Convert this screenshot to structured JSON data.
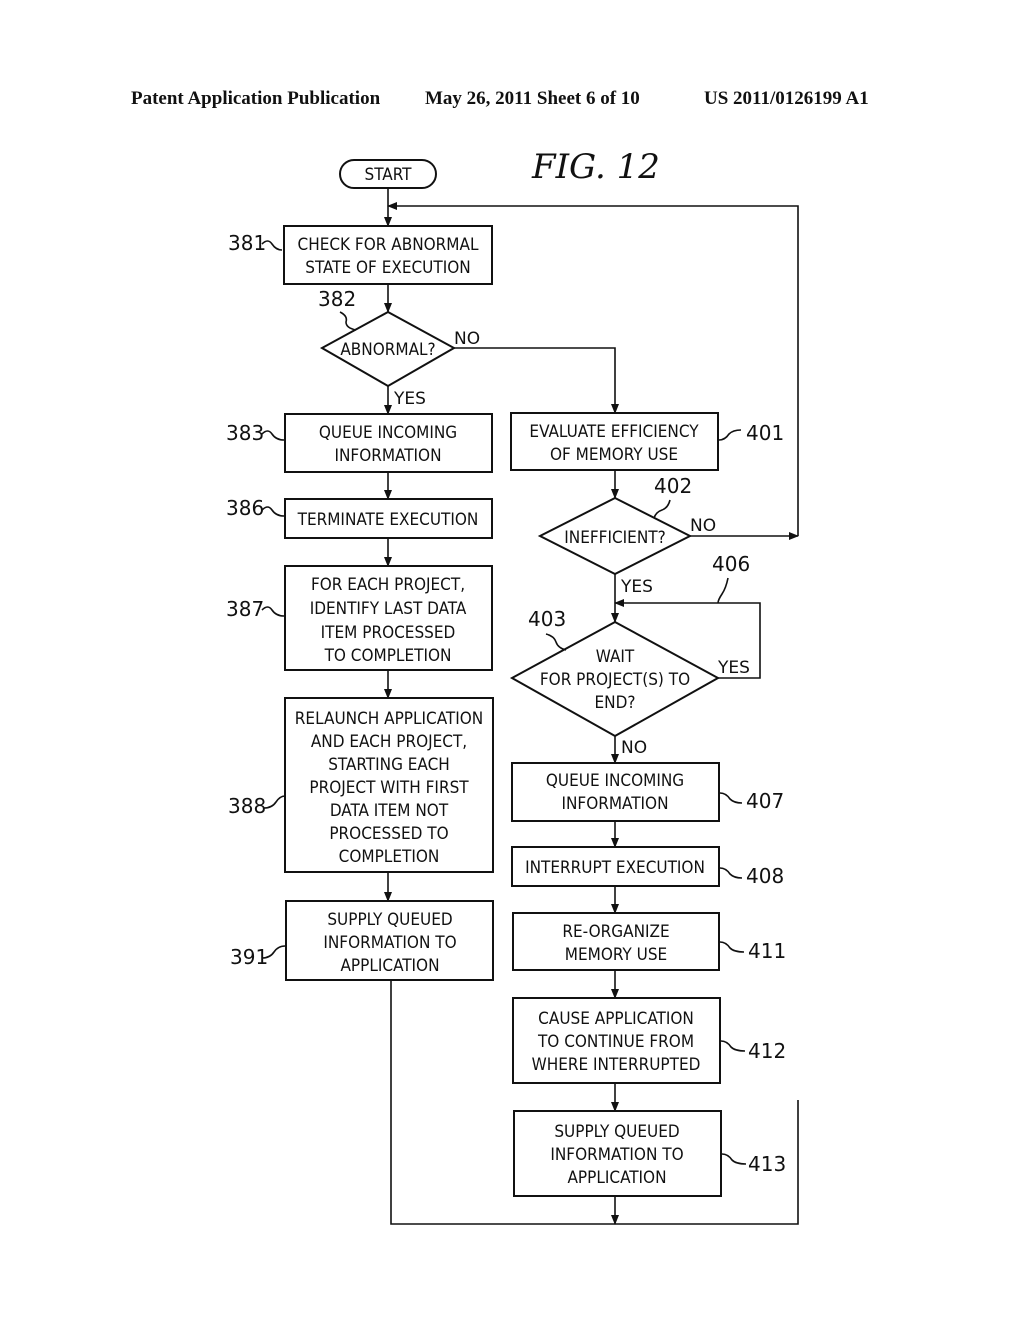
{
  "header": {
    "left": "Patent Application Publication",
    "center": "May 26, 2011  Sheet 6 of 10",
    "right": "US 2011/0126199 A1"
  },
  "figure": {
    "title": "FIG.  12",
    "start_label": "START"
  },
  "nodes": {
    "n381": {
      "ref": "381",
      "lines": [
        "CHECK FOR ABNORMAL",
        "STATE OF EXECUTION"
      ]
    },
    "n382": {
      "ref": "382",
      "lines": [
        "ABNORMAL?"
      ]
    },
    "n383": {
      "ref": "383",
      "lines": [
        "QUEUE INCOMING",
        "INFORMATION"
      ]
    },
    "n386": {
      "ref": "386",
      "lines": [
        "TERMINATE EXECUTION"
      ]
    },
    "n387": {
      "ref": "387",
      "lines": [
        "FOR EACH PROJECT,",
        "IDENTIFY LAST DATA",
        "ITEM PROCESSED",
        "TO COMPLETION"
      ]
    },
    "n388": {
      "ref": "388",
      "lines": [
        "RELAUNCH APPLICATION",
        "AND EACH PROJECT,",
        "STARTING EACH",
        "PROJECT WITH FIRST",
        "DATA ITEM NOT",
        "PROCESSED TO",
        "COMPLETION"
      ]
    },
    "n391": {
      "ref": "391",
      "lines": [
        "SUPPLY QUEUED",
        "INFORMATION TO",
        "APPLICATION"
      ]
    },
    "n401": {
      "ref": "401",
      "lines": [
        "EVALUATE EFFICIENCY",
        "OF MEMORY USE"
      ]
    },
    "n402": {
      "ref": "402",
      "lines": [
        "INEFFICIENT?"
      ]
    },
    "n403": {
      "ref": "403",
      "lines": [
        "WAIT",
        "FOR PROJECT(S) TO",
        "END?"
      ]
    },
    "n406": {
      "ref": "406"
    },
    "n407": {
      "ref": "407",
      "lines": [
        "QUEUE INCOMING",
        "INFORMATION"
      ]
    },
    "n408": {
      "ref": "408",
      "lines": [
        "INTERRUPT EXECUTION"
      ]
    },
    "n411": {
      "ref": "411",
      "lines": [
        "RE-ORGANIZE",
        "MEMORY USE"
      ]
    },
    "n412": {
      "ref": "412",
      "lines": [
        "CAUSE APPLICATION",
        "TO CONTINUE FROM",
        "WHERE INTERRUPTED"
      ]
    },
    "n413": {
      "ref": "413",
      "lines": [
        "SUPPLY QUEUED",
        "INFORMATION TO",
        "APPLICATION"
      ]
    }
  },
  "edge_labels": {
    "yes": "YES",
    "no": "NO"
  }
}
